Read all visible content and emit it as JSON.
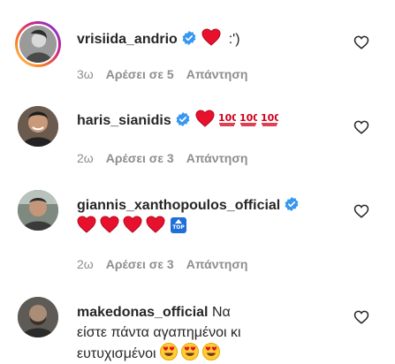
{
  "comments": [
    {
      "username": "vrisiida_andrio",
      "verified": true,
      "text": ":')",
      "emojis": [
        "red-heart"
      ],
      "time": "3ω",
      "likes": "Αρέσει σε 5",
      "reply": "Απάντηση"
    },
    {
      "username": "haris_sianidis",
      "verified": true,
      "text": "",
      "emojis": [
        "red-heart",
        "hundred-points",
        "hundred-points",
        "hundred-points"
      ],
      "time": "2ω",
      "likes": "Αρέσει σε 3",
      "reply": "Απάντηση"
    },
    {
      "username": "giannis_xanthopoulos_official",
      "verified": true,
      "text": "",
      "emojis": [
        "red-heart",
        "red-heart",
        "red-heart",
        "red-heart",
        "top-arrow"
      ],
      "time": "2ω",
      "likes": "Αρέσει σε 3",
      "reply": "Απάντηση"
    },
    {
      "username": "makedonas_official",
      "verified": false,
      "text": "Να είστε πάντα αγαπημένοι κι ευτυχισμένοι",
      "emojis": [
        "heart-eyes",
        "heart-eyes",
        "heart-eyes"
      ]
    }
  ],
  "top_badge_text": "TOP",
  "colors": {
    "verified": "#3897f0",
    "meta_text": "#8e8e8e",
    "heart": "#e0245e"
  }
}
